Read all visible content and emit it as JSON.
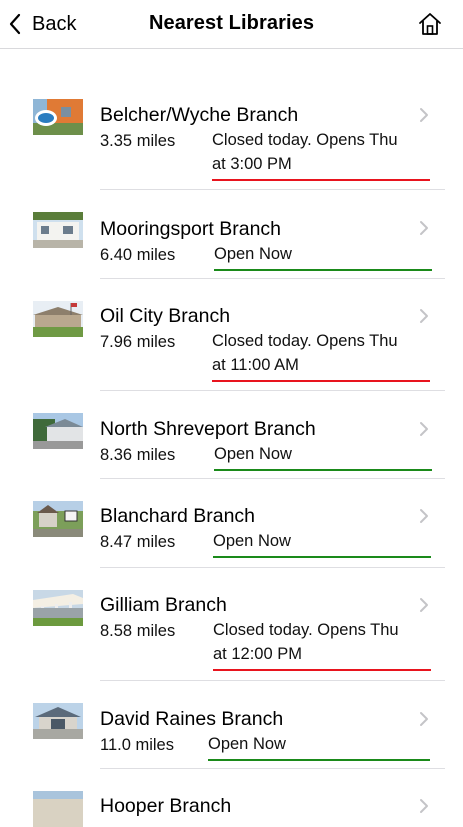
{
  "nav": {
    "back_label": "Back",
    "title": "Nearest Libraries"
  },
  "colors": {
    "open_underline": "#1a8a1a",
    "closed_underline": "#e8141e"
  },
  "libraries": [
    {
      "name": "Belcher/Wyche Branch",
      "distance": "3.35 miles",
      "status_line1": "Closed today. Opens Thu",
      "status_line2": "at 3:00 PM",
      "state": "closed"
    },
    {
      "name": "Mooringsport Branch",
      "distance": "6.40 miles",
      "status_line1": "Open Now",
      "status_line2": "",
      "state": "open"
    },
    {
      "name": "Oil City Branch",
      "distance": "7.96 miles",
      "status_line1": "Closed today. Opens Thu",
      "status_line2": "at 11:00 AM",
      "state": "closed"
    },
    {
      "name": "North Shreveport Branch",
      "distance": "8.36 miles",
      "status_line1": "Open Now",
      "status_line2": "",
      "state": "open"
    },
    {
      "name": "Blanchard Branch",
      "distance": "8.47 miles",
      "status_line1": "Open Now",
      "status_line2": "",
      "state": "open"
    },
    {
      "name": "Gilliam Branch",
      "distance": "8.58 miles",
      "status_line1": "Closed today. Opens Thu",
      "status_line2": "at 12:00 PM",
      "state": "closed"
    },
    {
      "name": "David Raines Branch",
      "distance": "11.0 miles",
      "status_line1": "Open Now",
      "status_line2": "",
      "state": "open"
    },
    {
      "name": "Hooper Branch",
      "distance": "",
      "status_line1": "",
      "status_line2": "",
      "state": "partial"
    }
  ]
}
